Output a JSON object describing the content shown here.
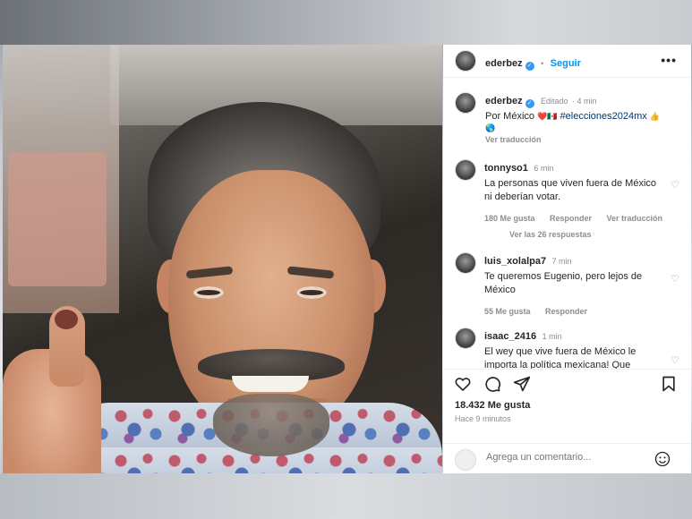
{
  "header": {
    "username": "ederbez",
    "separator": "•",
    "follow_label": "Seguir",
    "more_icon": "more-horizontal-icon"
  },
  "caption": {
    "username": "ederbez",
    "edited": "Editado",
    "time": "4 min",
    "text_prefix": "Por México ",
    "emojis": "❤️🇲🇽",
    "hashtag": "#elecciones2024mx",
    "emoji_end": "👍",
    "emoji_line2": "🌎",
    "see_translation": "Ver traducción"
  },
  "comments": [
    {
      "username": "tonnyso1",
      "time": "6 min",
      "text": "La personas que viven fuera de México ni deberían votar.",
      "likes": "180 Me gusta",
      "reply": "Responder",
      "translate": "Ver traducción",
      "view_replies": "Ver las 26 respuestas"
    },
    {
      "username": "luis_xolalpa7",
      "time": "7 min",
      "text": "Te queremos Eugenio, pero lejos de México",
      "likes": "55 Me gusta",
      "reply": "Responder"
    },
    {
      "username": "isaac_2416",
      "time": "1 min",
      "text": "El wey que vive fuera de México le importa la política mexicana! Que"
    }
  ],
  "actions": {
    "like_icon": "heart-icon",
    "comment_icon": "comment-icon",
    "share_icon": "send-icon",
    "save_icon": "bookmark-icon",
    "likes": "18.432 Me gusta",
    "time_ago": "Hace 9 minutos"
  },
  "comment_box": {
    "placeholder": "Agrega un comentario...",
    "emoji_icon": "smiley-icon"
  }
}
